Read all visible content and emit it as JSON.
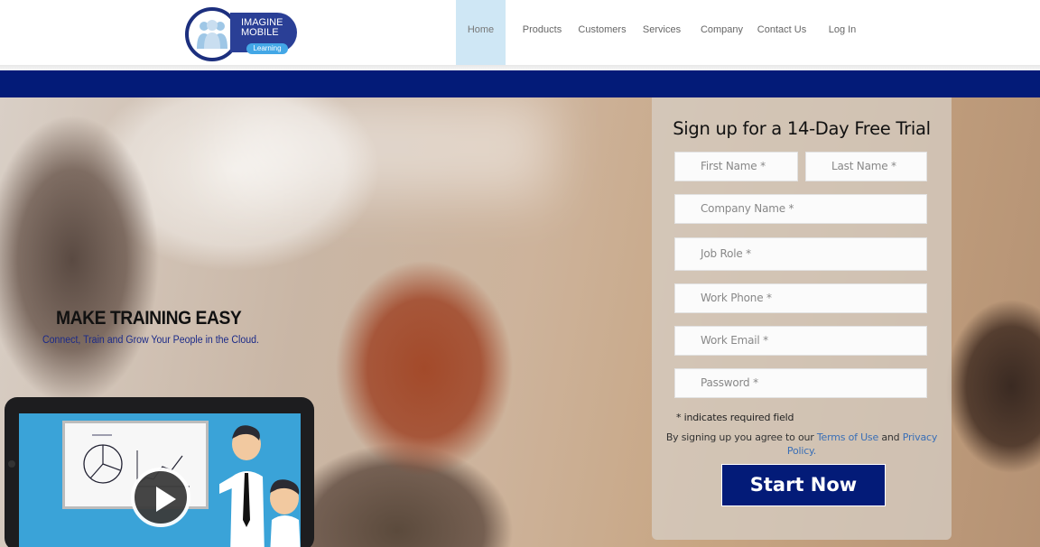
{
  "logo": {
    "line1": "IMAGINE",
    "line2": "MOBILE",
    "sub": "Learning"
  },
  "nav": {
    "items": [
      {
        "label": "Home"
      },
      {
        "label": "Products"
      },
      {
        "label": "Customers"
      },
      {
        "label": "Services"
      },
      {
        "label": "Company"
      },
      {
        "label": "Contact Us"
      },
      {
        "label": "Log In"
      }
    ],
    "active": "Home"
  },
  "hero": {
    "headline": "MAKE TRAINING EASY",
    "subheadline": "Connect, Train and Grow Your People in the Cloud."
  },
  "signup": {
    "title": "Sign up for a 14-Day Free Trial",
    "fields": {
      "first_name": "First Name *",
      "last_name": "Last Name *",
      "company": "Company Name *",
      "job_role": "Job Role *",
      "work_phone": "Work Phone *",
      "work_email": "Work Email *",
      "password": "Password *"
    },
    "required_note": "* indicates required field",
    "terms_prefix": "By signing up you agree to our",
    "terms_link": "Terms of Use",
    "terms_and": "and",
    "privacy_link": "Privacy Policy.",
    "submit_label": "Start Now"
  },
  "icons": {
    "logo": "people-group-icon",
    "video": "play-icon"
  },
  "colors": {
    "brand_navy": "#031b78",
    "nav_active_bg": "#cfe7f5",
    "link": "#3a6fb6",
    "tablet_screen": "#3aa3d8"
  }
}
